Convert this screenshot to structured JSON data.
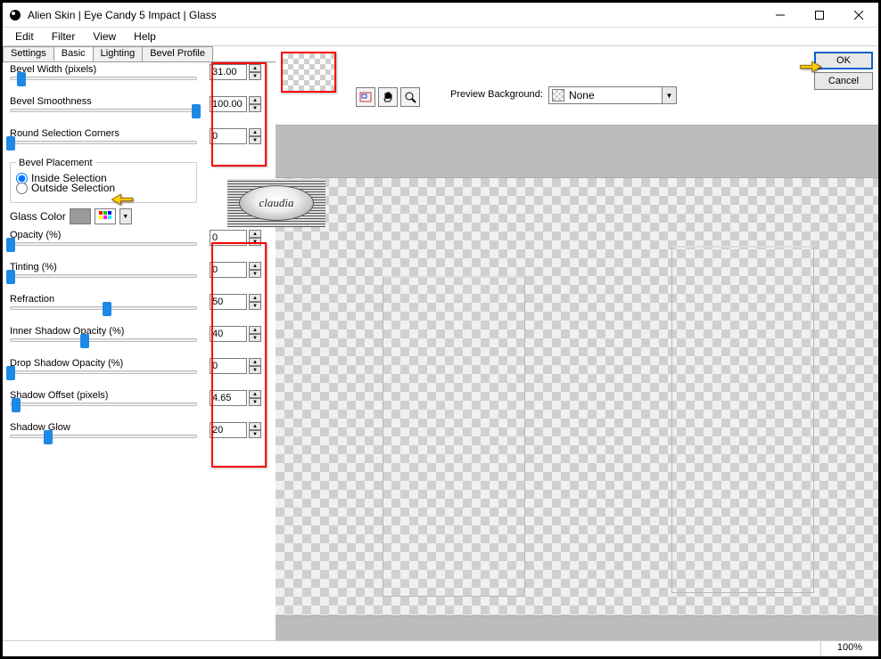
{
  "window": {
    "title": "Alien Skin | Eye Candy 5 Impact | Glass"
  },
  "menubar": [
    "Edit",
    "Filter",
    "View",
    "Help"
  ],
  "tabs": [
    "Settings",
    "Basic",
    "Lighting",
    "Bevel Profile"
  ],
  "active_tab": "Basic",
  "params": {
    "bevel_width": {
      "label": "Bevel Width (pixels)",
      "value": "31.00",
      "pos": 6
    },
    "bevel_smooth": {
      "label": "Bevel Smoothness",
      "value": "100.00",
      "pos": 100
    },
    "round_corners": {
      "label": "Round Selection Corners",
      "value": "0",
      "pos": 0
    },
    "opacity": {
      "label": "Opacity (%)",
      "value": "0",
      "pos": 0
    },
    "tinting": {
      "label": "Tinting (%)",
      "value": "0",
      "pos": 0
    },
    "refraction": {
      "label": "Refraction",
      "value": "50",
      "pos": 50
    },
    "inner_shadow": {
      "label": "Inner Shadow Opacity (%)",
      "value": "40",
      "pos": 40
    },
    "drop_shadow": {
      "label": "Drop Shadow Opacity (%)",
      "value": "0",
      "pos": 0
    },
    "shadow_offset": {
      "label": "Shadow Offset (pixels)",
      "value": "4.65",
      "pos": 3
    },
    "shadow_glow": {
      "label": "Shadow Glow",
      "value": "20",
      "pos": 20
    }
  },
  "bevel_placement": {
    "title": "Bevel Placement",
    "inside_label": "Inside Selection",
    "outside_label": "Outside Selection",
    "selected": "inside"
  },
  "glass_color_label": "Glass Color",
  "glass_color": "#9a9a9a",
  "preview": {
    "bg_label": "Preview Background:",
    "bg_value": "None"
  },
  "buttons": {
    "ok": "OK",
    "cancel": "Cancel"
  },
  "status": {
    "zoom": "100%"
  },
  "watermark": "claudia",
  "highlight_color": "#ff0000"
}
